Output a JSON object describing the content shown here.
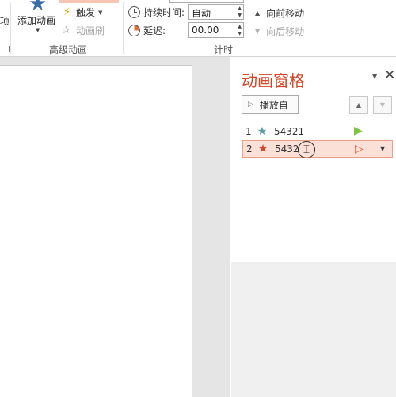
{
  "ribbon": {
    "edge_text": "项",
    "add_animation_label": "添加动画",
    "advanced_animation": {
      "group_label": "高级动画",
      "trigger_label": "触发",
      "animation_painter_label": "动画刷"
    },
    "timing": {
      "group_label": "计时",
      "duration_label": "持续时间:",
      "duration_value": "自动",
      "delay_label": "延迟:",
      "delay_value": "00.00",
      "move_earlier_label": "向前移动",
      "move_later_label": "向后移动"
    }
  },
  "animation_pane": {
    "title": "动画窗格",
    "play_button_label": "播放自",
    "items": [
      {
        "index": "1",
        "name": "54321",
        "star_color": "#5f9ea0",
        "selected": false
      },
      {
        "index": "2",
        "name": "5432",
        "star_color": "#d24726",
        "selected": true
      }
    ]
  },
  "colors": {
    "accent": "#d24726",
    "selection_fill": "#fbe0d7",
    "selection_border": "#ec9f86",
    "timeline_green": "#7cc243"
  }
}
